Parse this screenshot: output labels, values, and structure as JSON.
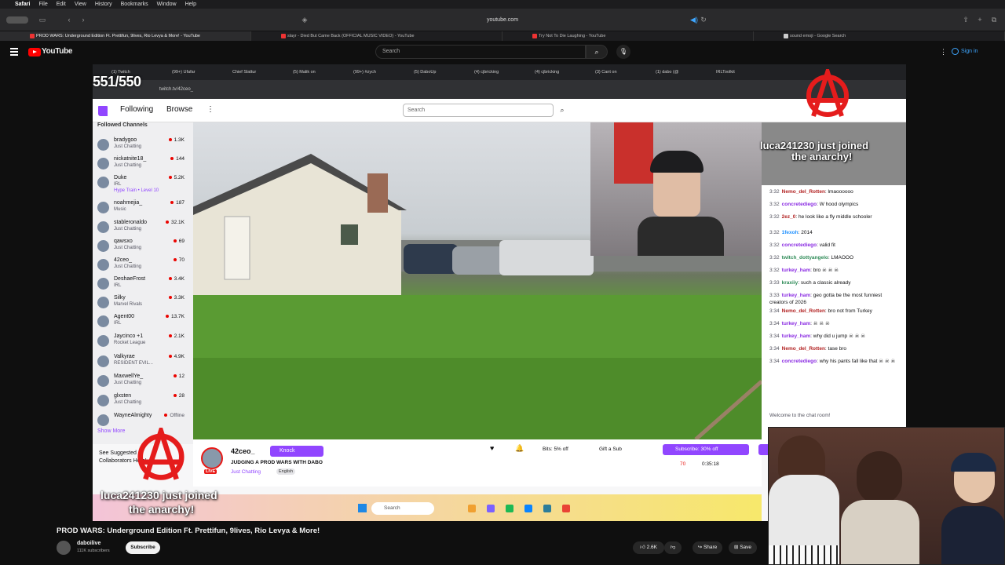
{
  "mac_menubar": {
    "items": [
      "Safari",
      "File",
      "Edit",
      "View",
      "History",
      "Bookmarks",
      "Window",
      "Help"
    ]
  },
  "safari": {
    "address": "youtube.com",
    "tabs": [
      "PROD WARS: Underground Edition Ft. Prettifun, 9lives, Rio Levya & More! - YouTube",
      "slayr - Died But Came Back (OFFICIAL MUSIC VIDEO) - YouTube",
      "Try Not To Die Laughing - YouTube",
      "sound emoji - Google Search"
    ]
  },
  "youtube": {
    "logo_text": "YouTube",
    "search_placeholder": "Search",
    "signin": "Sign in",
    "video_title": "PROD WARS: Underground Edition Ft. Prettifun, 9lives, Rio Levya & More!",
    "channel": "daboilive",
    "subscribers": "111K subscribers",
    "subscribe_label": "Subscribe",
    "likes": "2.6K",
    "share": "Share",
    "save": "Save"
  },
  "stream_browser": {
    "view_counter": "551/550",
    "url": "twitch.tv/42ceo_",
    "tabs": [
      "(1) Twitch",
      "(99+) Ufafar",
      "Chief Slattur",
      "(5) Malik on",
      "(99+) #zych",
      "(5) DaboUp",
      "(4) cjbricking",
      "(4) cjbricking",
      "(3) Cant on",
      "(1) dabo (@",
      "IRLToolkit"
    ]
  },
  "twitch": {
    "nav_following": "Following",
    "nav_browse": "Browse",
    "search_placeholder": "Search",
    "followed_header": "Followed Channels",
    "show_more": "Show More",
    "suggest_text": "See Suggested Collaborators Here!",
    "channels": [
      {
        "name": "bradygoo",
        "game": "Just Chatting",
        "count": "1.3K"
      },
      {
        "name": "nickatnite18_",
        "game": "Just Chatting",
        "count": "144"
      },
      {
        "name": "Duke",
        "game": "IRL",
        "count": "5.2K",
        "extra": "Hype Train • Level 10"
      },
      {
        "name": "noahmejia_",
        "game": "Music",
        "count": "187"
      },
      {
        "name": "stableronaldo",
        "game": "Just Chatting",
        "count": "32.1K"
      },
      {
        "name": "qawsxo",
        "game": "Just Chatting",
        "count": "69"
      },
      {
        "name": "42ceo_",
        "game": "Just Chatting",
        "count": "70"
      },
      {
        "name": "DeshaeFrost",
        "game": "IRL",
        "count": "3.4K"
      },
      {
        "name": "Silky",
        "game": "Marvel Rivals",
        "count": "3.3K"
      },
      {
        "name": "Agent00",
        "game": "IRL",
        "count": "13.7K"
      },
      {
        "name": "Jaycinco +1",
        "game": "Rocket League",
        "count": "2.1K"
      },
      {
        "name": "Valkyrae",
        "game": "RESIDENT EVIL...",
        "count": "4.9K"
      },
      {
        "name": "MaxwellYe_",
        "game": "Just Chatting",
        "count": "12"
      },
      {
        "name": "glxsten",
        "game": "Just Chatting",
        "count": "28"
      },
      {
        "name": "WayneAlmighty",
        "game": "",
        "count": "Offline"
      }
    ],
    "streamer": {
      "name": "42ceo_",
      "knock": "Knock",
      "live": "LIVE",
      "title": "JUDGING A PROD WARS WITH DABO",
      "category": "Just Chatting",
      "language": "English",
      "bits": "Bits: 5% off",
      "gift": "Gift a Sub",
      "subscribe": "Subscribe: 30% off",
      "viewers": "70",
      "uptime": "0:35:18"
    },
    "chat": [
      {
        "ts": "3:32",
        "user": "Nemo_del_Rotten",
        "color": "#b22222",
        "text": "lmaoooooo"
      },
      {
        "ts": "3:32",
        "user": "concretediego",
        "color": "#8a2be2",
        "text": "W hood olympics"
      },
      {
        "ts": "3:32",
        "user": "2ez_0",
        "color": "#b22222",
        "text": "he look like a fly middle schooler"
      },
      {
        "ts": "3:32",
        "user": "1fexoh",
        "color": "#1e90ff",
        "text": "2014"
      },
      {
        "ts": "3:32",
        "user": "concretediego",
        "color": "#8a2be2",
        "text": "valid fit"
      },
      {
        "ts": "3:32",
        "user": "twitch_dottyangelo",
        "color": "#2e8b57",
        "text": "LMAOOO"
      },
      {
        "ts": "3:32",
        "user": "turkey_ham",
        "color": "#8a2be2",
        "text": "bro ☠ ☠ ☠"
      },
      {
        "ts": "3:33",
        "user": "kraxiiy",
        "color": "#2e8b57",
        "text": "such a classic already"
      },
      {
        "ts": "3:33",
        "user": "turkey_ham",
        "color": "#8a2be2",
        "text": "geo gotta be the most funniest creators of 2026"
      },
      {
        "ts": "3:34",
        "user": "Nemo_del_Rotten",
        "color": "#b22222",
        "text": "bro not from Turkey"
      },
      {
        "ts": "3:34",
        "user": "turkey_ham",
        "color": "#8a2be2",
        "text": "☠ ☠ ☠"
      },
      {
        "ts": "3:34",
        "user": "turkey_ham",
        "color": "#8a2be2",
        "text": "why did u jump ☠ ☠ ☠"
      },
      {
        "ts": "3:34",
        "user": "Nemo_del_Rotten",
        "color": "#b22222",
        "text": "tase bro"
      },
      {
        "ts": "3:34",
        "user": "concretediego",
        "color": "#8a2be2",
        "text": "why his pants fall like that ☠ ☠ ☠"
      }
    ],
    "chat_welcome": "Welcome to the chat room!"
  },
  "taskbar": {
    "search": "Search"
  },
  "overlays": {
    "join_right_1": "luca241230 just joined",
    "join_right_2": "the anarchy!",
    "join_left_1": "luca241230 just joined",
    "join_left_2": "the anarchy!"
  }
}
